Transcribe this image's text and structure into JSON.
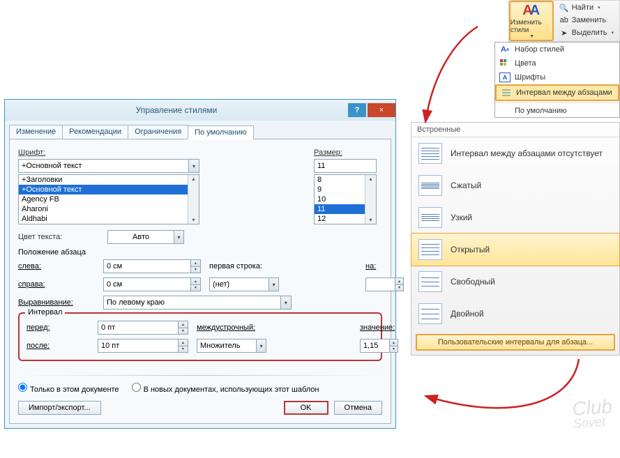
{
  "ribbon": {
    "big_button_label": "Изменить стили",
    "find": "Найти",
    "replace": "Заменить",
    "select": "Выделить"
  },
  "dropdown": {
    "items": [
      {
        "label": "Набор стилей"
      },
      {
        "label": "Цвета"
      },
      {
        "label": "Шрифты"
      },
      {
        "label": "Интервал между абзацами",
        "highlight": true
      },
      {
        "label": "По умолчанию"
      }
    ]
  },
  "spacing_panel": {
    "header": "Встроенные",
    "options": [
      "Интервал между абзацами отсутствует",
      "Сжатый",
      "Узкий",
      "Открытый",
      "Свободный",
      "Двойной"
    ],
    "selected_index": 3,
    "custom_link": "Пользовательские интервалы для абзаца..."
  },
  "dialog": {
    "title": "Управление стилями",
    "help_char": "?",
    "close_char": "×",
    "tabs": [
      "Изменение",
      "Рекомендации",
      "Ограничения",
      "По умолчанию"
    ],
    "active_tab": 3,
    "font": {
      "label": "Шрифт:",
      "value": "+Основной текст",
      "list": [
        "+Заголовки",
        "+Основной текст",
        "Agency FB",
        "Aharoni",
        "Aldhabi"
      ],
      "selected": "+Основной текст",
      "size_label": "Размер:",
      "size_value": "11",
      "size_list": [
        "8",
        "9",
        "10",
        "11",
        "12"
      ],
      "size_selected": "11"
    },
    "text_color_label": "Цвет текста:",
    "text_color_value": "Авто",
    "paragraph_header": "Положение абзаца",
    "left_label": "слева:",
    "left_value": "0 см",
    "right_label": "справа:",
    "right_value": "0 см",
    "align_label": "Выравнивание:",
    "align_value": "По левому краю",
    "firstline_label": "первая строка:",
    "firstline_value": "(нет)",
    "on_label": "на:",
    "on_value": "",
    "interval_header": "Интервал",
    "before_label": "перед:",
    "before_value": "0 пт",
    "after_label": "после:",
    "after_value": "10 пт",
    "linespacing_label": "междустрочный:",
    "linespacing_value": "Множитель",
    "value_label": "значение:",
    "value_value": "1,15",
    "radio_this_doc": "Только в этом документе",
    "radio_new_docs": "В новых документах, использующих этот шаблон",
    "radio_selected": 0,
    "import_export": "Импорт/экспорт...",
    "ok": "OK",
    "cancel": "Отмена"
  },
  "watermark": {
    "top": "Club",
    "bottom": "Sovet"
  }
}
